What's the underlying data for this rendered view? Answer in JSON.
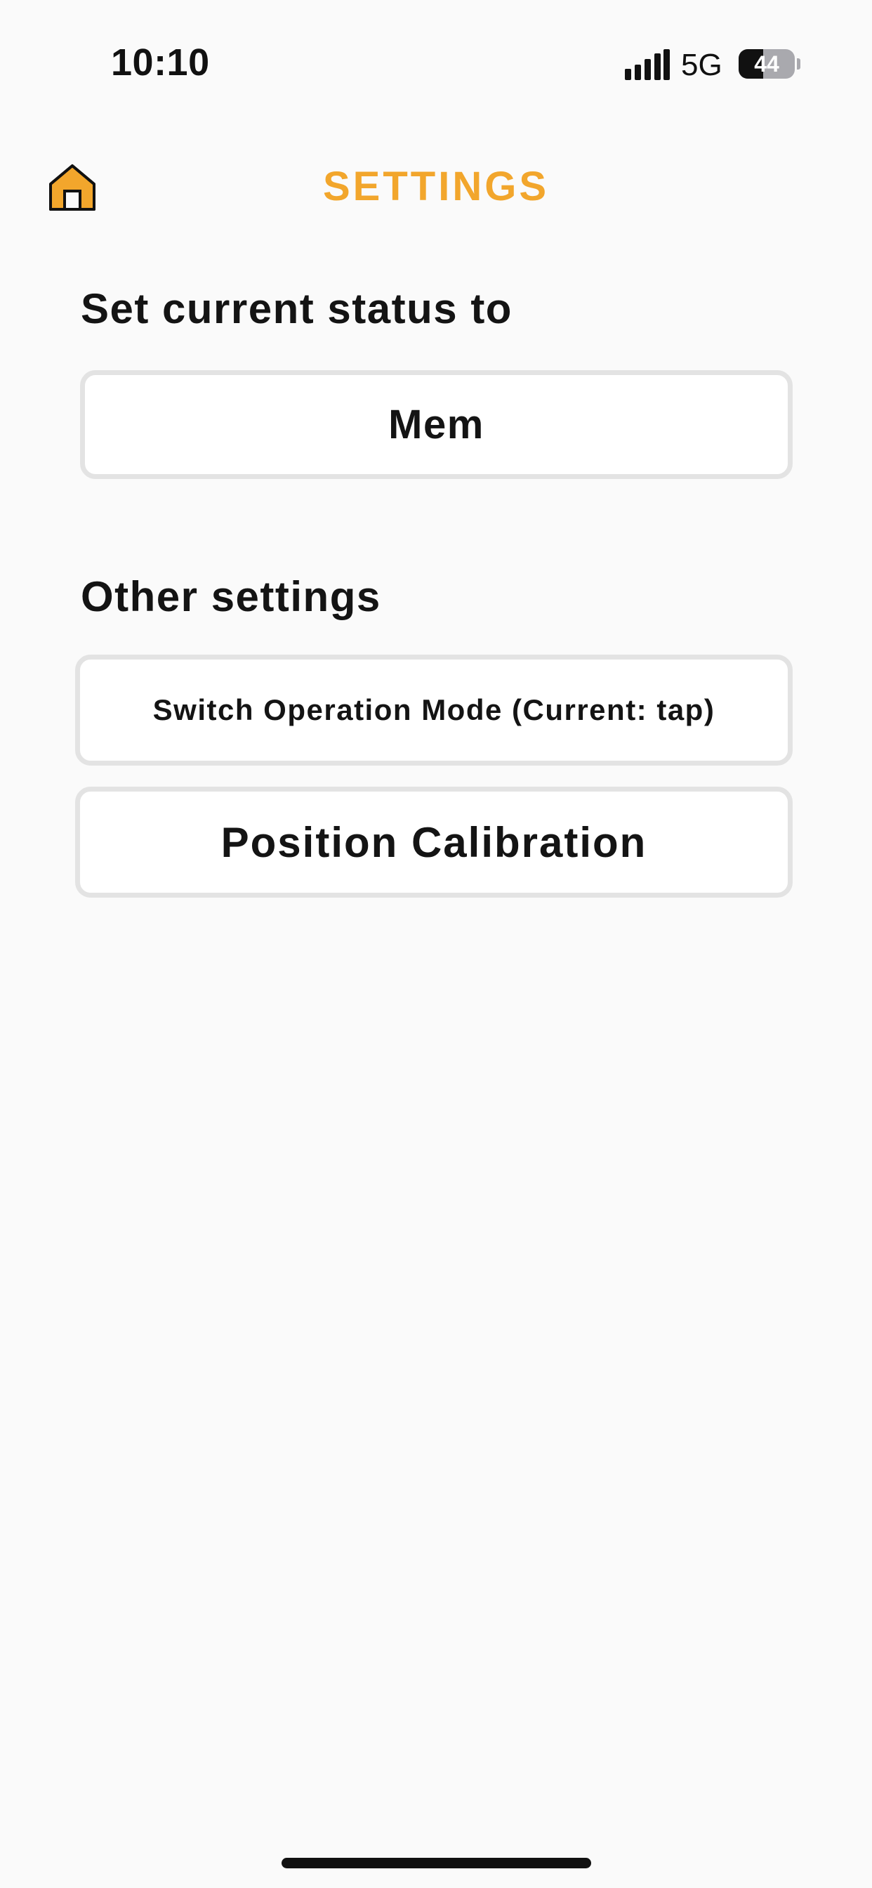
{
  "status_bar": {
    "time": "10:10",
    "signal_icon": "cellular-signal-icon",
    "network": "5G",
    "battery_level": "44",
    "battery_fraction": 0.44
  },
  "header": {
    "home_icon": "home-icon",
    "title": "SETTINGS",
    "accent_color": "#f2a62c"
  },
  "status_section": {
    "heading": "Set current status to",
    "button_label": "Mem"
  },
  "other_section": {
    "heading": "Other settings",
    "mode_button_label": "Switch Operation Mode (Current: tap)",
    "calibration_button_label": "Position Calibration"
  }
}
